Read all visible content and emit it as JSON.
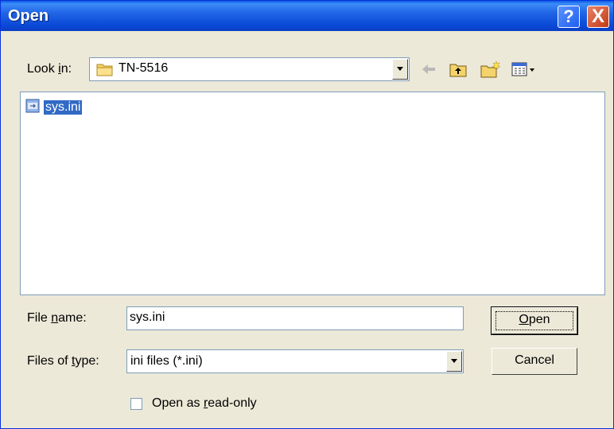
{
  "window": {
    "title": "Open",
    "help_symbol": "?",
    "close_symbol": "X"
  },
  "lookin": {
    "label_prefix": "Look ",
    "label_accel": "i",
    "label_suffix": "n:",
    "folder_icon": "folder-icon",
    "value": "TN-5516"
  },
  "toolbar": {
    "icons": [
      "back-arrow-icon",
      "up-folder-icon",
      "new-folder-icon",
      "view-menu-icon"
    ]
  },
  "files": [
    {
      "name": "sys.ini",
      "icon": "ini-file-icon",
      "selected": true
    }
  ],
  "filename": {
    "label_prefix": "File ",
    "label_accel": "n",
    "label_suffix": "ame:",
    "value": "sys.ini"
  },
  "filetype": {
    "label_prefix": "Files of ",
    "label_accel": "t",
    "label_suffix": "ype:",
    "value": "ini files (*.ini)"
  },
  "buttons": {
    "open_accel": "O",
    "open_rest": "pen",
    "cancel": "Cancel"
  },
  "readonly": {
    "label_prefix": "Open as ",
    "label_accel": "r",
    "label_suffix": "ead-only",
    "checked": false
  },
  "colors": {
    "titlebar": "#0a4ad8",
    "selection": "#316ac5",
    "dialog_bg": "#ece9d8"
  }
}
